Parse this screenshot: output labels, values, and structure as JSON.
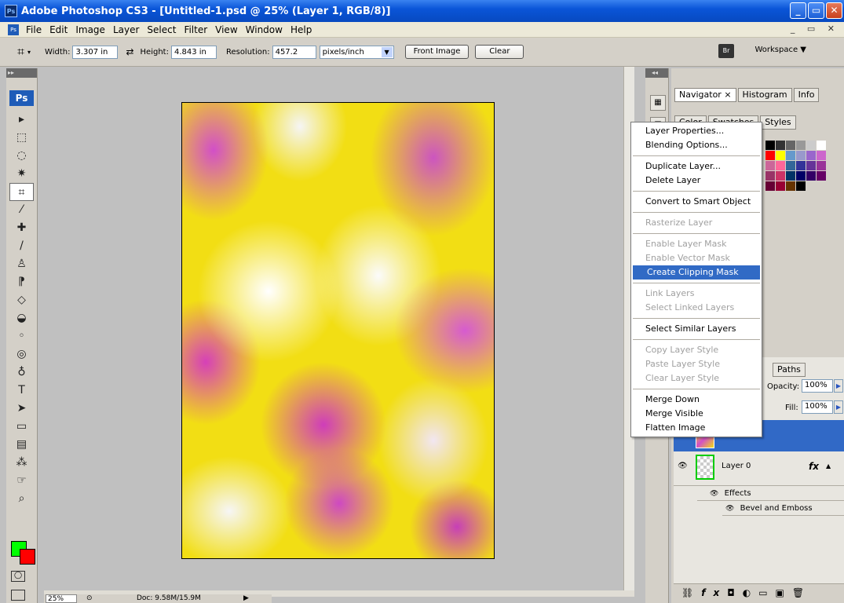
{
  "window": {
    "title": "Adobe Photoshop CS3 - [Untitled-1.psd @ 25% (Layer 1, RGB/8)]"
  },
  "menubar": {
    "items": [
      "File",
      "Edit",
      "Image",
      "Layer",
      "Select",
      "Filter",
      "View",
      "Window",
      "Help"
    ]
  },
  "options": {
    "width_label": "Width:",
    "width_value": "3.307 in",
    "height_label": "Height:",
    "height_value": "4.843 in",
    "resolution_label": "Resolution:",
    "resolution_value": "457.2",
    "units": "pixels/inch",
    "front_image_label": "Front Image",
    "clear_label": "Clear",
    "workspace_label": "Workspace ▼"
  },
  "toolbar": {
    "tools": [
      "move-tool-icon",
      "marquee-tool-icon",
      "lasso-tool-icon",
      "magic-wand-icon",
      "crop-tool-icon",
      "slice-tool-icon",
      "healing-brush-icon",
      "brush-tool-icon",
      "clone-stamp-icon",
      "history-brush-icon",
      "eraser-icon",
      "paint-bucket-icon",
      "blur-tool-icon",
      "dodge-tool-icon",
      "pen-tool-icon",
      "type-tool-icon",
      "path-selection-icon",
      "shape-tool-icon",
      "notes-tool-icon",
      "eyedropper-icon",
      "hand-tool-icon",
      "zoom-tool-icon"
    ],
    "tool_glyphs": [
      "▸",
      "⬚",
      "◌",
      "✷",
      "⌗",
      "⁄",
      "✚",
      "/",
      "♙",
      "⁋",
      "◇",
      "◒",
      "◦",
      "◎",
      "♁",
      "T",
      "➤",
      "▭",
      "▤",
      "⁂",
      "☞",
      "⌕"
    ],
    "foreground_color": "#00ff00",
    "background_color": "#ff0000"
  },
  "status": {
    "zoom": "25%",
    "doc": "Doc: 9.58M/15.9M"
  },
  "panels": {
    "top_tabs": [
      "Navigator ×",
      "Histogram",
      "Info"
    ],
    "mid_tabs": [
      "Color",
      "Swatches",
      "Styles"
    ],
    "layers_tabs": [
      "Paths"
    ],
    "opacity_label": "Opacity:",
    "opacity_value": "100%",
    "fill_label": "Fill:",
    "fill_value": "100%",
    "layer0_name": "Layer 0",
    "fx_badge": "fx",
    "effects_label": "Effects",
    "bevel_label": "Bevel and Emboss"
  },
  "context_menu": {
    "items": [
      {
        "label": "Layer Properties...",
        "enabled": true
      },
      {
        "label": "Blending Options...",
        "enabled": true
      },
      {
        "sep": true
      },
      {
        "label": "Duplicate Layer...",
        "enabled": true
      },
      {
        "label": "Delete Layer",
        "enabled": true
      },
      {
        "sep": true
      },
      {
        "label": "Convert to Smart Object",
        "enabled": true
      },
      {
        "sep": true
      },
      {
        "label": "Rasterize Layer",
        "enabled": false
      },
      {
        "sep": true
      },
      {
        "label": "Enable Layer Mask",
        "enabled": false
      },
      {
        "label": "Enable Vector Mask",
        "enabled": false
      },
      {
        "label": "Create Clipping Mask",
        "enabled": true,
        "highlighted": true
      },
      {
        "sep": true
      },
      {
        "label": "Link Layers",
        "enabled": false
      },
      {
        "label": "Select Linked Layers",
        "enabled": false
      },
      {
        "sep": true
      },
      {
        "label": "Select Similar Layers",
        "enabled": true
      },
      {
        "sep": true
      },
      {
        "label": "Copy Layer Style",
        "enabled": false
      },
      {
        "label": "Paste Layer Style",
        "enabled": false
      },
      {
        "label": "Clear Layer Style",
        "enabled": false
      },
      {
        "sep": true
      },
      {
        "label": "Merge Down",
        "enabled": true
      },
      {
        "label": "Merge Visible",
        "enabled": true
      },
      {
        "label": "Flatten Image",
        "enabled": true
      }
    ]
  },
  "swatch_colors": [
    "#000000",
    "#333333",
    "#666666",
    "#999999",
    "#cccccc",
    "#ffffff",
    "#ff0000",
    "#ffff00",
    "#6699cc",
    "#9999cc",
    "#9966cc",
    "#cc66cc",
    "#cc6699",
    "#ff6699",
    "#336699",
    "#333399",
    "#663399",
    "#993399",
    "#993366",
    "#cc3366",
    "#003366",
    "#000066",
    "#330066",
    "#660066",
    "#660033",
    "#990033",
    "#663300",
    "#000000"
  ]
}
